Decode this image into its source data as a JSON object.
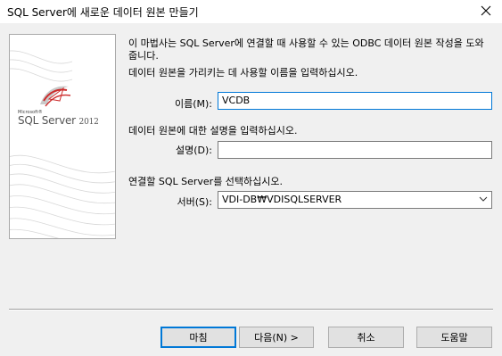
{
  "window": {
    "title": "SQL Server에 새로운 데이터 원본 만들기",
    "close_glyph": "✕"
  },
  "banner": {
    "logo_small": "Microsoft®",
    "logo_main": "SQL Server",
    "logo_year": "2012",
    "logo_icon": "sql-server-logo-icon",
    "accent_color": "#cc2b2b"
  },
  "intro_text_line1": "이 마법사는 SQL Server에 연결할 때 사용할 수 있는 ODBC 데이터 원본 작성을 도와",
  "intro_text_line2": "줍니다.",
  "name_prompt": "데이터 원본을 가리키는 데 사용할 이름을 입력하십시오.",
  "name_label": "이름(M):",
  "name_value": "VCDB",
  "description_prompt": "데이터 원본에 대한 설명을 입력하십시오.",
  "description_label": "설명(D):",
  "description_value": "",
  "server_prompt": "연결할 SQL Server를 선택하십시오.",
  "server_label": "서버(S):",
  "server_value": "VDI-DB₩VDISQLSERVER",
  "buttons": {
    "finish": "마침",
    "next": "다음(N) >",
    "cancel": "취소",
    "help": "도움말"
  }
}
